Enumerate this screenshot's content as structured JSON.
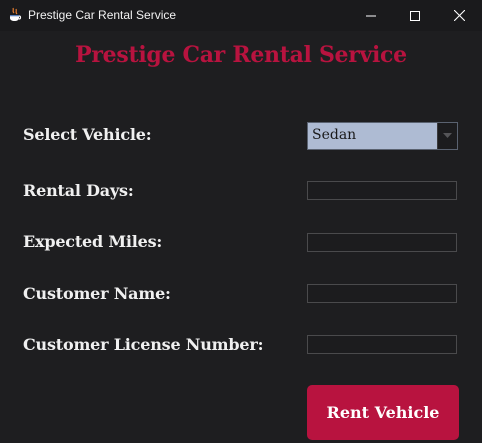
{
  "window": {
    "title": "Prestige Car Rental Service",
    "icon": "java-cup-icon"
  },
  "heading": "Prestige Car Rental Service",
  "form": {
    "vehicle_label": "Select Vehicle:",
    "vehicle_selected": "Sedan",
    "rental_days_label": "Rental Days:",
    "rental_days_value": "",
    "expected_miles_label": "Expected Miles:",
    "expected_miles_value": "",
    "customer_name_label": "Customer Name:",
    "customer_name_value": "",
    "license_label": "Customer License Number:",
    "license_value": ""
  },
  "actions": {
    "rent_label": "Rent Vehicle"
  },
  "colors": {
    "accent": "#b8133f",
    "background": "#1e1e20",
    "select_bg": "#aebbd3"
  }
}
